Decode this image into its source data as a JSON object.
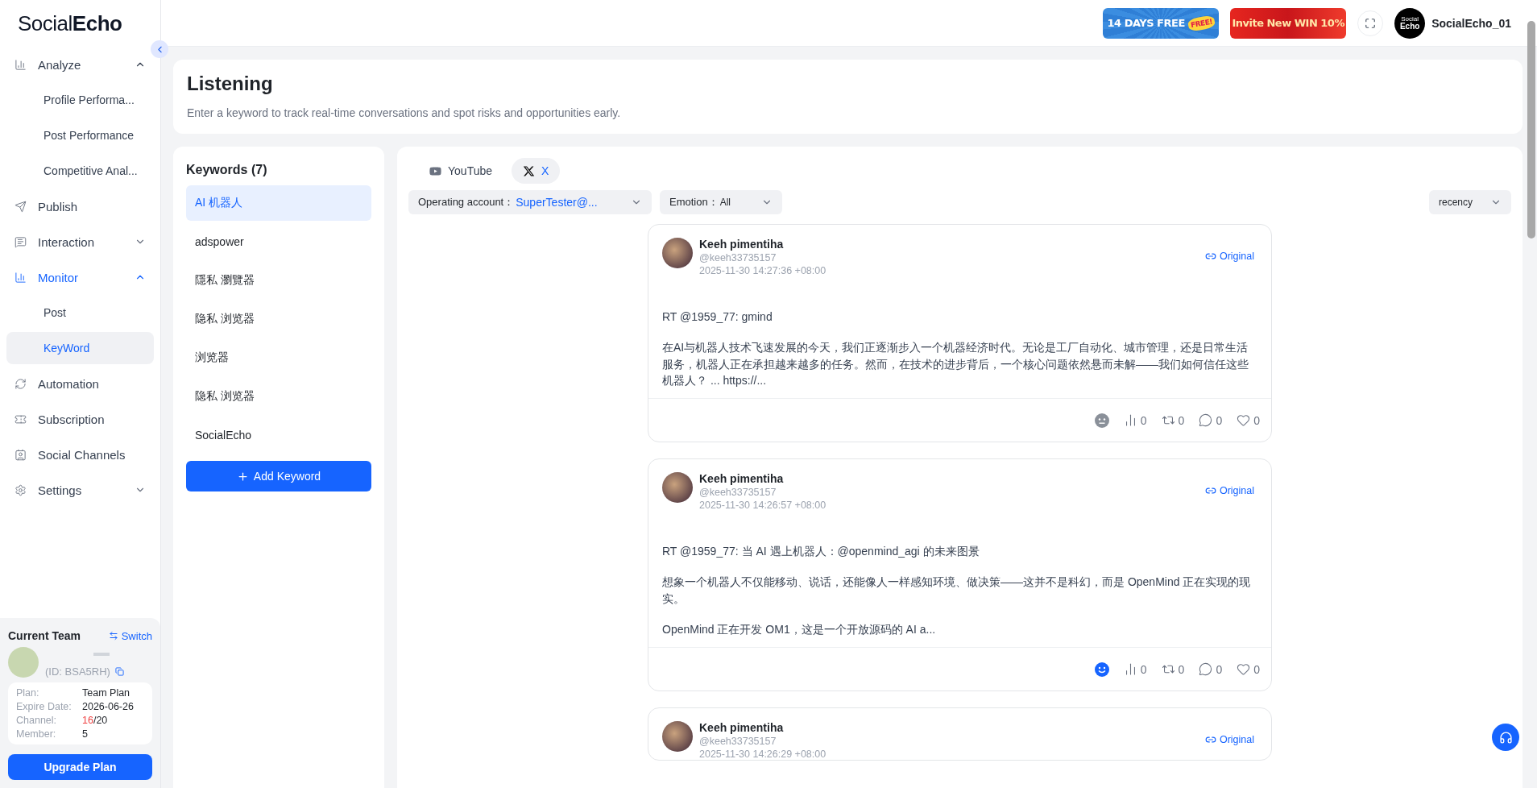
{
  "brand": {
    "light": "Social",
    "bold": "Echo"
  },
  "topbar": {
    "promos": [
      {
        "kind": "trial",
        "text": "14 DAYS FREE",
        "burst": "FREE!"
      },
      {
        "kind": "invite",
        "text": "Invite New WIN 10%"
      }
    ],
    "user": {
      "avatar_top": "Social",
      "avatar_bottom": "Echo",
      "name": "SocialEcho_01"
    }
  },
  "sidebar": {
    "items": [
      {
        "kind": "group",
        "label": "Analyze",
        "expanded": true,
        "selected": false,
        "children": [
          {
            "label": "Profile Performa...",
            "selected": false
          },
          {
            "label": "Post Performance",
            "selected": false
          },
          {
            "label": "Competitive Anal...",
            "selected": false
          }
        ]
      },
      {
        "kind": "item",
        "label": "Publish",
        "selected": false
      },
      {
        "kind": "group",
        "label": "Interaction",
        "expanded": false,
        "selected": false
      },
      {
        "kind": "group",
        "label": "Monitor",
        "expanded": true,
        "selected": true,
        "children": [
          {
            "label": "Post",
            "selected": false
          },
          {
            "label": "KeyWord",
            "selected": true
          }
        ]
      },
      {
        "kind": "item",
        "label": "Automation",
        "selected": false
      },
      {
        "kind": "item",
        "label": "Subscription",
        "selected": false
      },
      {
        "kind": "item",
        "label": "Social Channels",
        "selected": false
      },
      {
        "kind": "group",
        "label": "Settings",
        "expanded": false,
        "selected": false
      }
    ],
    "team": {
      "title": "Current Team",
      "switch": "Switch",
      "id": "(ID: BSA5RH)",
      "details": [
        {
          "label": "Plan:",
          "value": "Team Plan"
        },
        {
          "label": "Expire Date:",
          "value": "2026-06-26"
        },
        {
          "label": "Channel:",
          "used": "16",
          "value": "/20"
        },
        {
          "label": "Member:",
          "value": "5"
        }
      ],
      "upgrade": "Upgrade Plan"
    }
  },
  "header": {
    "title": "Listening",
    "subtitle": "Enter a keyword to track real-time conversations and spot risks and opportunities early."
  },
  "keywords": {
    "title": "Keywords (7)",
    "items": [
      {
        "label": "AI 机器人",
        "selected": true
      },
      {
        "label": "adspower",
        "selected": false
      },
      {
        "label": "隱私 瀏覽器",
        "selected": false
      },
      {
        "label": "隐私 浏览器",
        "selected": false
      },
      {
        "label": "浏览器",
        "selected": false
      },
      {
        "label": "隐私 浏览器",
        "selected": false
      },
      {
        "label": "SocialEcho",
        "selected": false
      }
    ],
    "add": "Add Keyword"
  },
  "feed": {
    "tabs": [
      {
        "kind": "youtube",
        "label": "YouTube",
        "selected": false
      },
      {
        "kind": "x",
        "label": "X",
        "selected": true
      }
    ],
    "filters": [
      {
        "label": "Operating account：",
        "value": "SuperTester@..."
      },
      {
        "label": "Emotion：",
        "value": "All"
      }
    ],
    "sort": "recency",
    "posts": [
      {
        "name": "Keeh pimentiha",
        "handle": "@keeh33735157",
        "time": "2025-11-30 14:27:36 +08:00",
        "link": "Original",
        "paragraphs": [
          "RT @1959_77: gmind",
          "在AI与机器人技术飞速发展的今天，我们正逐渐步入一个机器经济时代。无论是工厂自动化、城市管理，还是日常生活服务，机器人正在承担越来越多的任务。然而，在技术的进步背后，一个核心问题依然悬而未解——我们如何信任这些机器人？ ... https://..."
        ],
        "kind": "neutral",
        "stats": [
          "0",
          "0",
          "0",
          "0"
        ]
      },
      {
        "name": "Keeh pimentiha",
        "handle": "@keeh33735157",
        "time": "2025-11-30 14:26:57 +08:00",
        "link": "Original",
        "paragraphs": [
          "RT @1959_77: 当 AI 遇上机器人：@openmind_agi  的未来图景",
          "想象一个机器人不仅能移动、说话，还能像人一样感知环境、做决策——这并不是科幻，而是 OpenMind 正在实现的现实。",
          "OpenMind 正在开发 OM1，这是一个开放源码的 AI a..."
        ],
        "kind": "positive",
        "stats": [
          "0",
          "0",
          "0",
          "0"
        ]
      },
      {
        "name": "Keeh pimentiha",
        "handle": "@keeh33735157",
        "time": "2025-11-30 14:26:29 +08:00",
        "link": "Original"
      }
    ]
  }
}
